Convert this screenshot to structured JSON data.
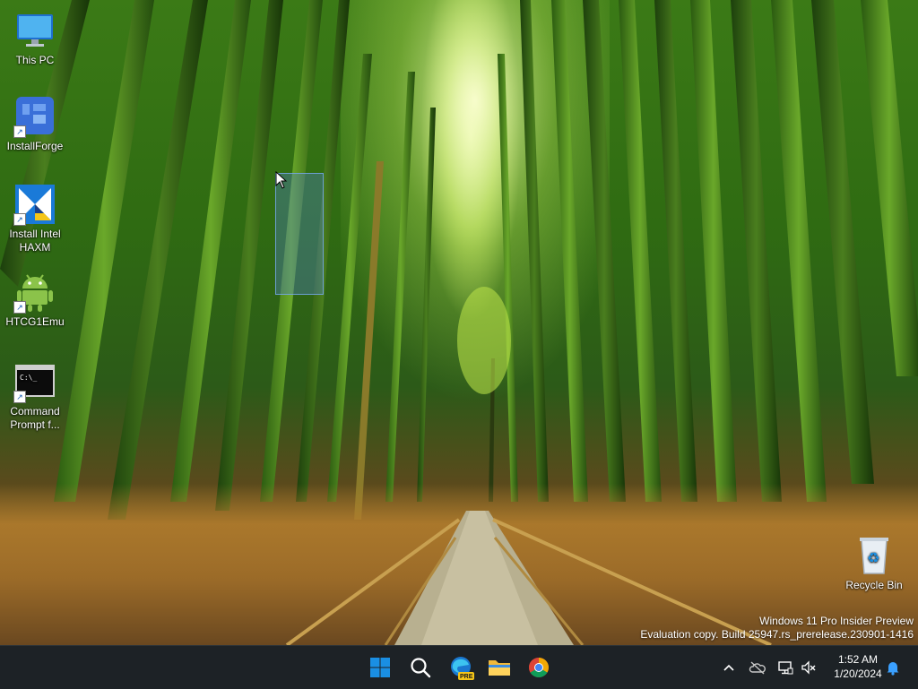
{
  "desktop": {
    "icons": [
      {
        "label": "This PC",
        "icon": "monitor-icon",
        "shortcut": false
      },
      {
        "label": "InstallForge",
        "icon": "installforge-icon",
        "shortcut": true
      },
      {
        "label": "Install Intel HAXM",
        "icon": "intel-haxm-installer-icon",
        "shortcut": true
      },
      {
        "label": "HTCG1Emu",
        "icon": "android-icon",
        "shortcut": true
      },
      {
        "label": "Command Prompt f...",
        "icon": "command-prompt-icon",
        "shortcut": true
      }
    ],
    "recycle_bin": {
      "label": "Recycle Bin",
      "icon": "recycle-bin-icon"
    },
    "watermark": {
      "line1": "Windows 11 Pro Insider Preview",
      "line2": "Evaluation copy. Build 25947.rs_prerelease.230901-1416"
    }
  },
  "taskbar": {
    "pinned": [
      {
        "name": "Start",
        "icon": "windows-logo-icon"
      },
      {
        "name": "Search",
        "icon": "search-icon"
      },
      {
        "name": "Microsoft Edge Beta",
        "icon": "edge-icon",
        "badge": "PRE"
      },
      {
        "name": "File Explorer",
        "icon": "folder-icon"
      },
      {
        "name": "Google Chrome",
        "icon": "chrome-icon"
      }
    ],
    "tray": {
      "icons": [
        "chevron-up-icon",
        "onedrive-offline-icon",
        "network-icon",
        "volume-muted-icon",
        "notification-bell-icon"
      ]
    },
    "clock": {
      "time": "1:52 AM",
      "date": "1/20/2024"
    }
  },
  "colors": {
    "taskbar_bg": "#1d2226",
    "accent_blue": "#1a8fe3",
    "bamboo_green": "#3b7a16"
  }
}
